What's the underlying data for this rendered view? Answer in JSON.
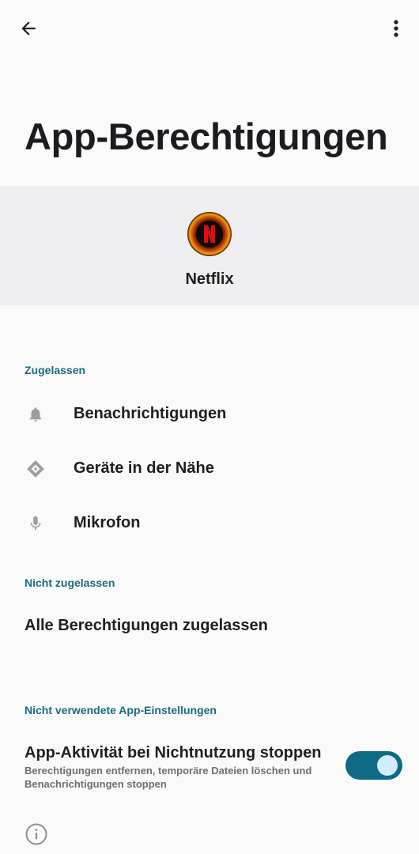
{
  "page": {
    "title": "App-Berechtigungen"
  },
  "app": {
    "name": "Netflix"
  },
  "sections": {
    "allowed": {
      "header": "Zugelassen",
      "items": [
        {
          "label": "Benachrichtigungen",
          "icon": "bell-icon"
        },
        {
          "label": "Geräte in der Nähe",
          "icon": "nearby-devices-icon"
        },
        {
          "label": "Mikrofon",
          "icon": "microphone-icon"
        }
      ]
    },
    "not_allowed": {
      "header": "Nicht zugelassen",
      "items": [
        {
          "label": "Alle Berechtigungen zugelassen"
        }
      ]
    },
    "unused": {
      "header": "Nicht verwendete App-Einstellungen",
      "toggle": {
        "title": "App-Aktivität bei Nichtnutzung stoppen",
        "subtitle": "Berechtigungen entfernen, temporäre Dateien löschen und Benachrichtigungen stoppen",
        "enabled": true
      }
    }
  },
  "colors": {
    "accent": "#1b6c80",
    "switch_on": "#0f6a86",
    "header_bg": "#efeff1"
  }
}
